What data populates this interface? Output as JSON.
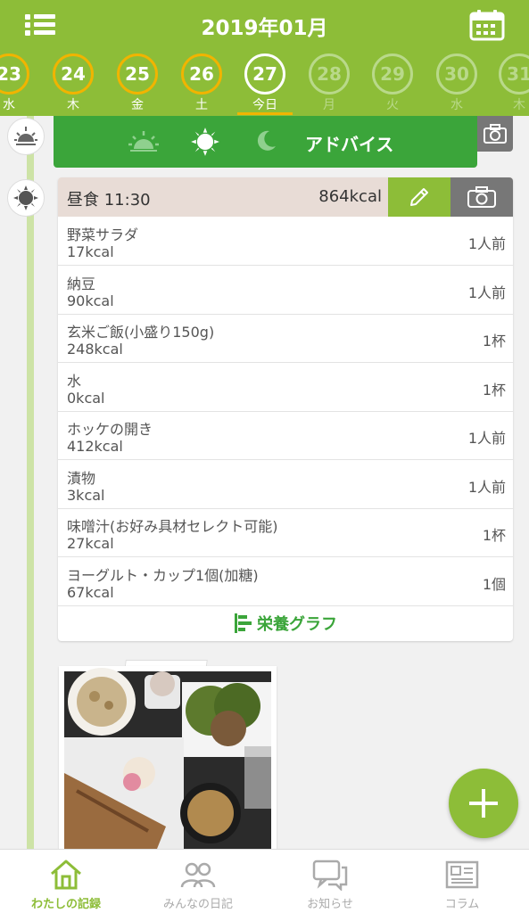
{
  "header": {
    "title": "2019年01月"
  },
  "days": [
    {
      "num": "23",
      "wd": "水",
      "state": "past"
    },
    {
      "num": "24",
      "wd": "木",
      "state": "past"
    },
    {
      "num": "25",
      "wd": "金",
      "state": "past"
    },
    {
      "num": "26",
      "wd": "土",
      "state": "past"
    },
    {
      "num": "27",
      "wd": "今日",
      "state": "today"
    },
    {
      "num": "28",
      "wd": "月",
      "state": "future"
    },
    {
      "num": "29",
      "wd": "火",
      "state": "future"
    },
    {
      "num": "30",
      "wd": "水",
      "state": "future"
    },
    {
      "num": "31",
      "wd": "木",
      "state": "future"
    }
  ],
  "advice": {
    "label": "アドバイス"
  },
  "meal": {
    "title": "昼食 11:30",
    "kcal": "864kcal",
    "items": [
      {
        "name": "野菜サラダ",
        "kcal": "17kcal",
        "qty": "1人前"
      },
      {
        "name": "納豆",
        "kcal": "90kcal",
        "qty": "1人前"
      },
      {
        "name": "玄米ご飯(小盛り150g)",
        "kcal": "248kcal",
        "qty": "1杯"
      },
      {
        "name": "水",
        "kcal": "0kcal",
        "qty": "1杯"
      },
      {
        "name": "ホッケの開き",
        "kcal": "412kcal",
        "qty": "1人前"
      },
      {
        "name": "漬物",
        "kcal": "3kcal",
        "qty": "1人前"
      },
      {
        "name": "味噌汁(お好み具材セレクト可能)",
        "kcal": "27kcal",
        "qty": "1杯"
      },
      {
        "name": "ヨーグルト・カップ1個(加糖)",
        "kcal": "67kcal",
        "qty": "1個"
      }
    ],
    "graph_label": "栄養グラフ"
  },
  "nav": {
    "items": [
      {
        "label": "わたしの記録",
        "icon": "home-icon",
        "active": true
      },
      {
        "label": "みんなの日記",
        "icon": "people-icon",
        "active": false
      },
      {
        "label": "お知らせ",
        "icon": "chat-icon",
        "active": false
      },
      {
        "label": "コラム",
        "icon": "newspaper-icon",
        "active": false
      }
    ]
  },
  "colors": {
    "brand_green": "#8dbd38",
    "advice_green": "#3ba53a",
    "accent_orange": "#f1b400"
  }
}
